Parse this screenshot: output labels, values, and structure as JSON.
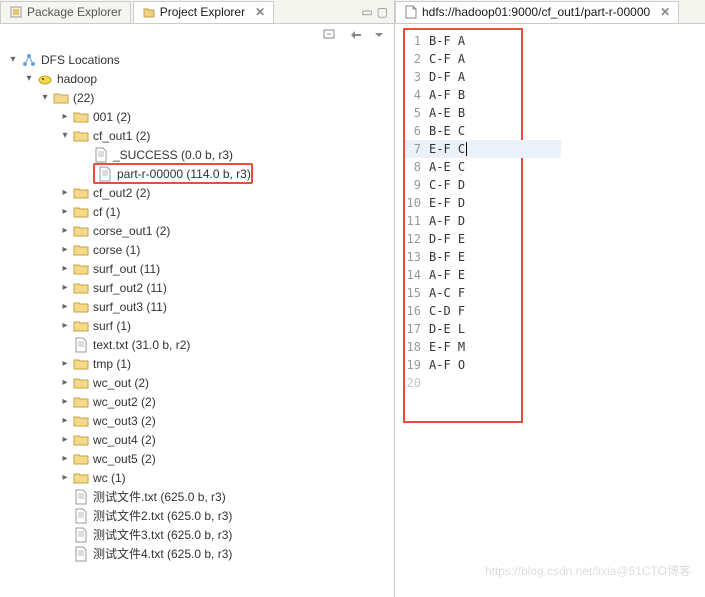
{
  "left": {
    "tabs": [
      {
        "label": "Package Explorer",
        "active": false
      },
      {
        "label": "Project Explorer",
        "active": true
      }
    ],
    "tree": [
      {
        "depth": 0,
        "twisty": "open",
        "icon": "dfs",
        "label": "DFS Locations"
      },
      {
        "depth": 1,
        "twisty": "open",
        "icon": "hadoop",
        "label": "hadoop"
      },
      {
        "depth": 2,
        "twisty": "open",
        "icon": "folder",
        "label": "(22)"
      },
      {
        "depth": 3,
        "twisty": "closed",
        "icon": "folder",
        "label": "001 (2)"
      },
      {
        "depth": 3,
        "twisty": "open",
        "icon": "folder",
        "label": "cf_out1 (2)"
      },
      {
        "depth": 4,
        "twisty": "none",
        "icon": "file",
        "label": "_SUCCESS (0.0 b, r3)"
      },
      {
        "depth": 4,
        "twisty": "none",
        "icon": "file",
        "label": "part-r-00000 (114.0 b, r3)",
        "highlighted": true
      },
      {
        "depth": 3,
        "twisty": "closed",
        "icon": "folder",
        "label": "cf_out2 (2)"
      },
      {
        "depth": 3,
        "twisty": "closed",
        "icon": "folder",
        "label": "cf (1)"
      },
      {
        "depth": 3,
        "twisty": "closed",
        "icon": "folder",
        "label": "corse_out1 (2)"
      },
      {
        "depth": 3,
        "twisty": "closed",
        "icon": "folder",
        "label": "corse (1)"
      },
      {
        "depth": 3,
        "twisty": "closed",
        "icon": "folder",
        "label": "surf_out (11)"
      },
      {
        "depth": 3,
        "twisty": "closed",
        "icon": "folder",
        "label": "surf_out2 (11)"
      },
      {
        "depth": 3,
        "twisty": "closed",
        "icon": "folder",
        "label": "surf_out3 (11)"
      },
      {
        "depth": 3,
        "twisty": "closed",
        "icon": "folder",
        "label": "surf (1)"
      },
      {
        "depth": 3,
        "twisty": "none",
        "icon": "file",
        "label": "text.txt (31.0 b, r2)"
      },
      {
        "depth": 3,
        "twisty": "closed",
        "icon": "folder",
        "label": "tmp (1)"
      },
      {
        "depth": 3,
        "twisty": "closed",
        "icon": "folder",
        "label": "wc_out (2)"
      },
      {
        "depth": 3,
        "twisty": "closed",
        "icon": "folder",
        "label": "wc_out2 (2)"
      },
      {
        "depth": 3,
        "twisty": "closed",
        "icon": "folder",
        "label": "wc_out3 (2)"
      },
      {
        "depth": 3,
        "twisty": "closed",
        "icon": "folder",
        "label": "wc_out4 (2)"
      },
      {
        "depth": 3,
        "twisty": "closed",
        "icon": "folder",
        "label": "wc_out5 (2)"
      },
      {
        "depth": 3,
        "twisty": "closed",
        "icon": "folder",
        "label": "wc (1)"
      },
      {
        "depth": 3,
        "twisty": "none",
        "icon": "file",
        "label": "测试文件.txt (625.0 b, r3)"
      },
      {
        "depth": 3,
        "twisty": "none",
        "icon": "file",
        "label": "测试文件2.txt (625.0 b, r3)"
      },
      {
        "depth": 3,
        "twisty": "none",
        "icon": "file",
        "label": "测试文件3.txt (625.0 b, r3)"
      },
      {
        "depth": 3,
        "twisty": "none",
        "icon": "file",
        "label": "测试文件4.txt (625.0 b, r3)"
      }
    ]
  },
  "right": {
    "tab": {
      "label": "hdfs://hadoop01:9000/cf_out1/part-r-00000"
    },
    "lines": [
      {
        "n": "1",
        "text": "B-F  A"
      },
      {
        "n": "2",
        "text": "C-F  A"
      },
      {
        "n": "3",
        "text": "D-F  A"
      },
      {
        "n": "4",
        "text": "A-F  B"
      },
      {
        "n": "5",
        "text": "A-E  B"
      },
      {
        "n": "6",
        "text": "B-E  C"
      },
      {
        "n": "7",
        "text": "E-F  C",
        "cursor": true
      },
      {
        "n": "8",
        "text": "A-E  C"
      },
      {
        "n": "9",
        "text": "C-F  D"
      },
      {
        "n": "10",
        "text": "E-F  D"
      },
      {
        "n": "11",
        "text": "A-F  D"
      },
      {
        "n": "12",
        "text": "D-F  E"
      },
      {
        "n": "13",
        "text": "B-F  E"
      },
      {
        "n": "14",
        "text": "A-F  E"
      },
      {
        "n": "15",
        "text": "A-C  F"
      },
      {
        "n": "16",
        "text": "C-D  F"
      },
      {
        "n": "17",
        "text": "D-E  L"
      },
      {
        "n": "18",
        "text": "E-F  M"
      },
      {
        "n": "19",
        "text": "A-F  O"
      }
    ],
    "next_line": "20"
  },
  "watermark": "https://blog.csdn.net/lixia@51CTO博客"
}
